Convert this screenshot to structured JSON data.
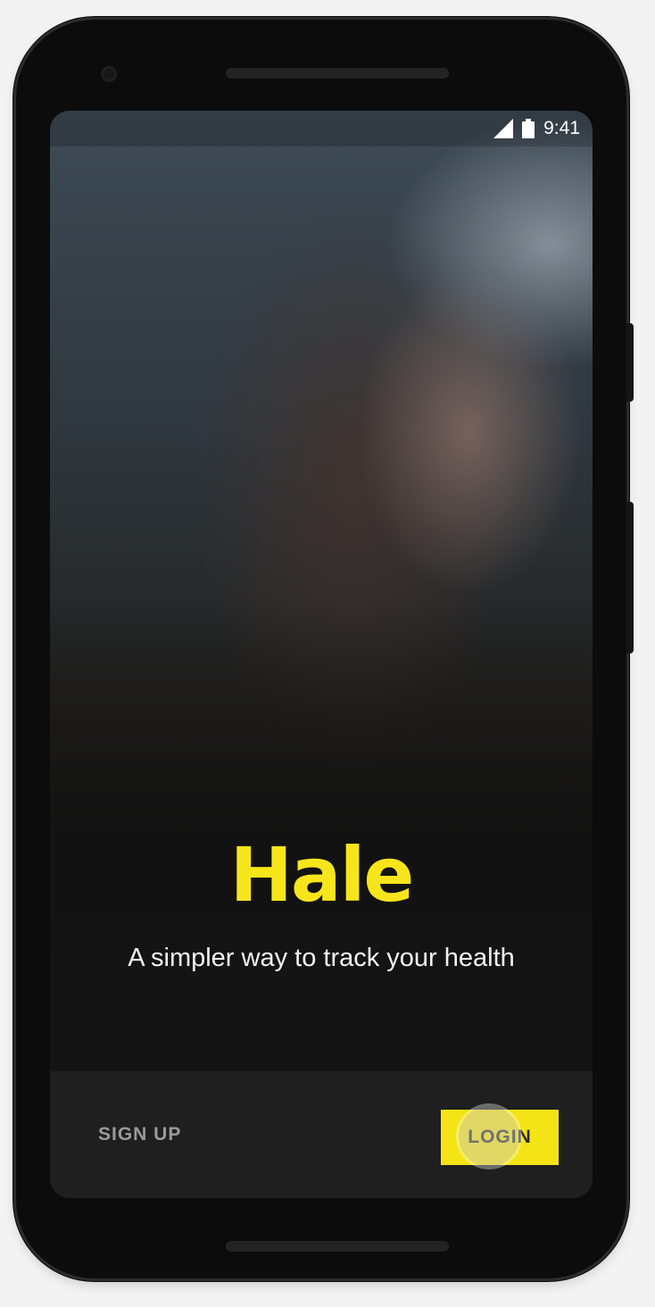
{
  "status_bar": {
    "time": "9:41",
    "icons": [
      "signal-icon",
      "battery-icon"
    ]
  },
  "brand": {
    "name": "Hale",
    "tagline": "A simpler way to track your health",
    "accent_color": "#f5e415"
  },
  "actions": {
    "signup_label": "SIGN UP",
    "login_label": "LOGIN"
  }
}
